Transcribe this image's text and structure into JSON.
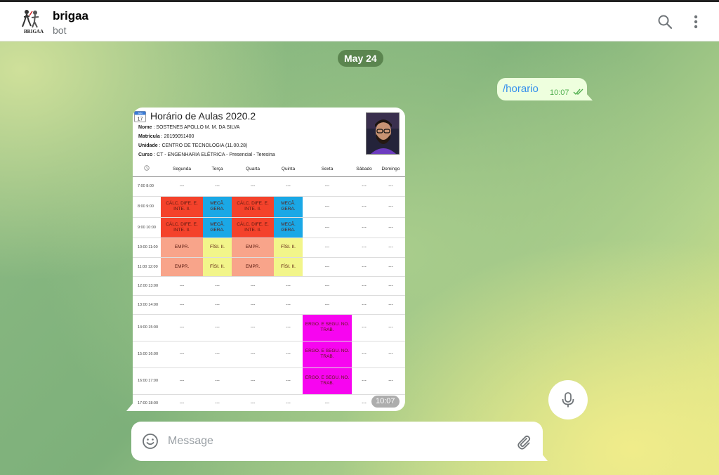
{
  "header": {
    "title": "brigaa",
    "status": "bot",
    "avatar_text": "BRIGAA"
  },
  "chat": {
    "date_label": "May 24",
    "outgoing": {
      "text": "/horario",
      "time": "10:07"
    },
    "photo_time": "10:07"
  },
  "schedule": {
    "calendar_month": "JAN",
    "calendar_day": "17",
    "title": "Horário de Aulas 2020.2",
    "info": [
      {
        "label": "Nome",
        "value": "SOSTENES APOLLO M. M. DA SILVA"
      },
      {
        "label": "Matrícula",
        "value": "20199051400"
      },
      {
        "label": "Unidade",
        "value": "CENTRO DE TECNOLOGIA (11.00.28)"
      },
      {
        "label": "Curso",
        "value": "CT - ENGENHARIA ELÉTRICA - Presencial - Teresina"
      }
    ],
    "days": [
      "Segunda",
      "Terça",
      "Quarta",
      "Quinta",
      "Sexta",
      "Sábado",
      "Domingo"
    ],
    "rows": [
      {
        "time": "7:00 8:00",
        "cells": [
          "---",
          "---",
          "---",
          "---",
          "---",
          "---",
          "---"
        ]
      },
      {
        "time": "8:00 9:00",
        "cells": [
          "CÁLC. DIFE. E. INTE. II.",
          "MECÂ. GERA.",
          "CÁLC. DIFE. E. INTE. II.",
          "MECÂ. GERA.",
          "---",
          "---",
          "---"
        ]
      },
      {
        "time": "9:00 10:00",
        "cells": [
          "CÁLC. DIFE. E. INTE. II.",
          "MECÂ. GERA.",
          "CÁLC. DIFE. E. INTE. II.",
          "MECÂ. GERA.",
          "---",
          "---",
          "---"
        ]
      },
      {
        "time": "10:00 11:00",
        "cells": [
          "EMPR.",
          "FÍSI. II.",
          "EMPR.",
          "FÍSI. II.",
          "---",
          "---",
          "---"
        ]
      },
      {
        "time": "11:00 12:00",
        "cells": [
          "EMPR.",
          "FÍSI. II.",
          "EMPR.",
          "FÍSI. II.",
          "---",
          "---",
          "---"
        ]
      },
      {
        "time": "12:00 13:00",
        "cells": [
          "---",
          "---",
          "---",
          "---",
          "---",
          "---",
          "---"
        ]
      },
      {
        "time": "13:00 14:00",
        "cells": [
          "---",
          "---",
          "---",
          "---",
          "---",
          "---",
          "---"
        ]
      },
      {
        "time": "14:00 15:00",
        "cells": [
          "---",
          "---",
          "---",
          "---",
          "ERGO. E SEGU. NO. TRAB.",
          "---",
          "---"
        ]
      },
      {
        "time": "15:00 16:00",
        "cells": [
          "---",
          "---",
          "---",
          "---",
          "ERGO. E SEGU. NO. TRAB.",
          "---",
          "---"
        ]
      },
      {
        "time": "16:00 17:00",
        "cells": [
          "---",
          "---",
          "---",
          "---",
          "ERGO. E SEGU. NO. TRAB.",
          "---",
          "---"
        ]
      },
      {
        "time": "17:00 18:00",
        "cells": [
          "---",
          "---",
          "---",
          "---",
          "---",
          "---",
          "---"
        ]
      }
    ],
    "subject_colors": {
      "CÁLC. DIFE. E. INTE. II.": "#f4422b",
      "MECÂ. GERA.": "#1aa8e6",
      "EMPR.": "#f8a48a",
      "FÍSI. II.": "#f2f58a",
      "ERGO. E SEGU. NO. TRAB.": "#f705f0"
    }
  },
  "composer": {
    "placeholder": "Message"
  }
}
